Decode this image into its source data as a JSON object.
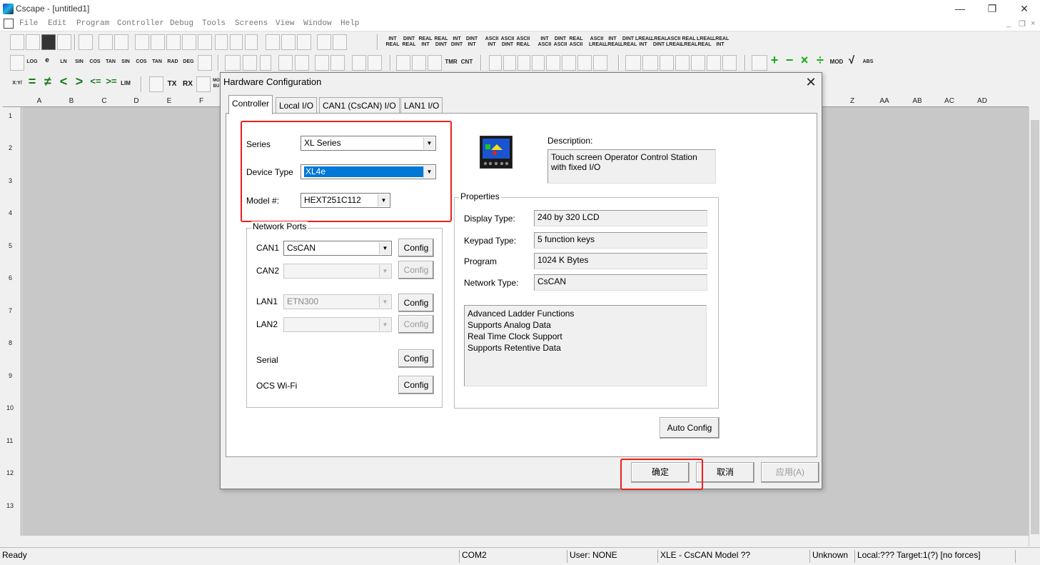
{
  "window": {
    "title": "Cscape - [untitled1]",
    "controls": {
      "minimize": "—",
      "restore": "❐",
      "close": "✕"
    }
  },
  "menu": {
    "items": [
      "File",
      "Edit",
      "Program",
      "Controller",
      "Debug",
      "Tools",
      "Screens",
      "View",
      "Window",
      "Help"
    ],
    "mdi_controls": [
      "_",
      "❐",
      "×"
    ]
  },
  "toolbar3_labels": [
    "X:Y/",
    "LIM",
    "TX",
    "RX",
    "MO BU"
  ],
  "toolbar2_labels": [
    "LOG",
    "e",
    "LN",
    "SIN",
    "COS",
    "TAN",
    "SIN",
    "COS",
    "TAN",
    "RAD",
    "DEG",
    "TMR",
    "CNT",
    "MOD",
    "ABS"
  ],
  "toolbar1_labels": [
    "INT REAL",
    "DINT REAL",
    "REAL INT",
    "REAL DINT",
    "INT DINT",
    "DINT INT",
    "ASCII INT",
    "ASCII DINT",
    "ASCII REAL",
    "INT ASCII",
    "DINT ASCII",
    "REAL ASCII",
    "ASCII LREAL",
    "INT LREAL",
    "DINT LREAL",
    "LREAL INT",
    "LREAL DINT",
    "ASCII LREAL",
    "REAL LREAL",
    "LREAL REAL",
    "LREAL INT"
  ],
  "columns_left": [
    "A",
    "B",
    "C",
    "D",
    "E",
    "F"
  ],
  "columns_right": [
    "Z",
    "AA",
    "AB",
    "AC",
    "AD"
  ],
  "rows": [
    "1",
    "2",
    "3",
    "4",
    "5",
    "6",
    "7",
    "8",
    "9",
    "10",
    "11",
    "12",
    "13"
  ],
  "status": {
    "ready": "Ready",
    "port": "COM2",
    "user": "User: NONE",
    "model": "XLE - CsCAN Model ??",
    "unknown": "Unknown",
    "local": "Local:??? Target:1(?) [no forces]"
  },
  "dialog": {
    "title": "Hardware Configuration",
    "close": "✕",
    "tabs": [
      "Controller",
      "Local I/O",
      "CAN1 (CsCAN) I/O",
      "LAN1 I/O"
    ],
    "series": {
      "label": "Series",
      "value": "XL Series"
    },
    "device_type": {
      "label": "Device Type",
      "value": "XL4e"
    },
    "model": {
      "label": "Model #:",
      "value": "HEXT251C112"
    },
    "network_ports": {
      "title": "Network Ports",
      "can1": {
        "label": "CAN1",
        "value": "CsCAN",
        "button": "Config"
      },
      "can2": {
        "label": "CAN2",
        "value": "",
        "button": "Config"
      },
      "lan1": {
        "label": "LAN1",
        "value": "ETN300",
        "button": "Config"
      },
      "lan2": {
        "label": "LAN2",
        "value": "",
        "button": "Config"
      },
      "serial": {
        "label": "Serial",
        "button": "Config"
      },
      "wifi": {
        "label": "OCS Wi-Fi",
        "button": "Config"
      }
    },
    "description": {
      "label": "Description:",
      "text": "Touch screen Operator Control Station with fixed I/O"
    },
    "properties": {
      "title": "Properties",
      "display_type": {
        "label": "Display Type:",
        "value": "240 by 320 LCD"
      },
      "keypad_type": {
        "label": "Keypad Type:",
        "value": "5 function keys"
      },
      "program": {
        "label": "Program",
        "value": "1024 K Bytes"
      },
      "network_type": {
        "label": "Network Type:",
        "value": "CsCAN"
      },
      "features": [
        "Advanced Ladder Functions",
        "Supports Analog Data",
        "Real Time Clock Support",
        "Supports Retentive Data"
      ]
    },
    "auto_config": "Auto Config",
    "ok": "确定",
    "cancel": "取消",
    "apply": "应用(A)"
  },
  "colors": {
    "highlight": "#e8201d",
    "selection": "#0078d7",
    "grid": "#c8c8c8"
  }
}
